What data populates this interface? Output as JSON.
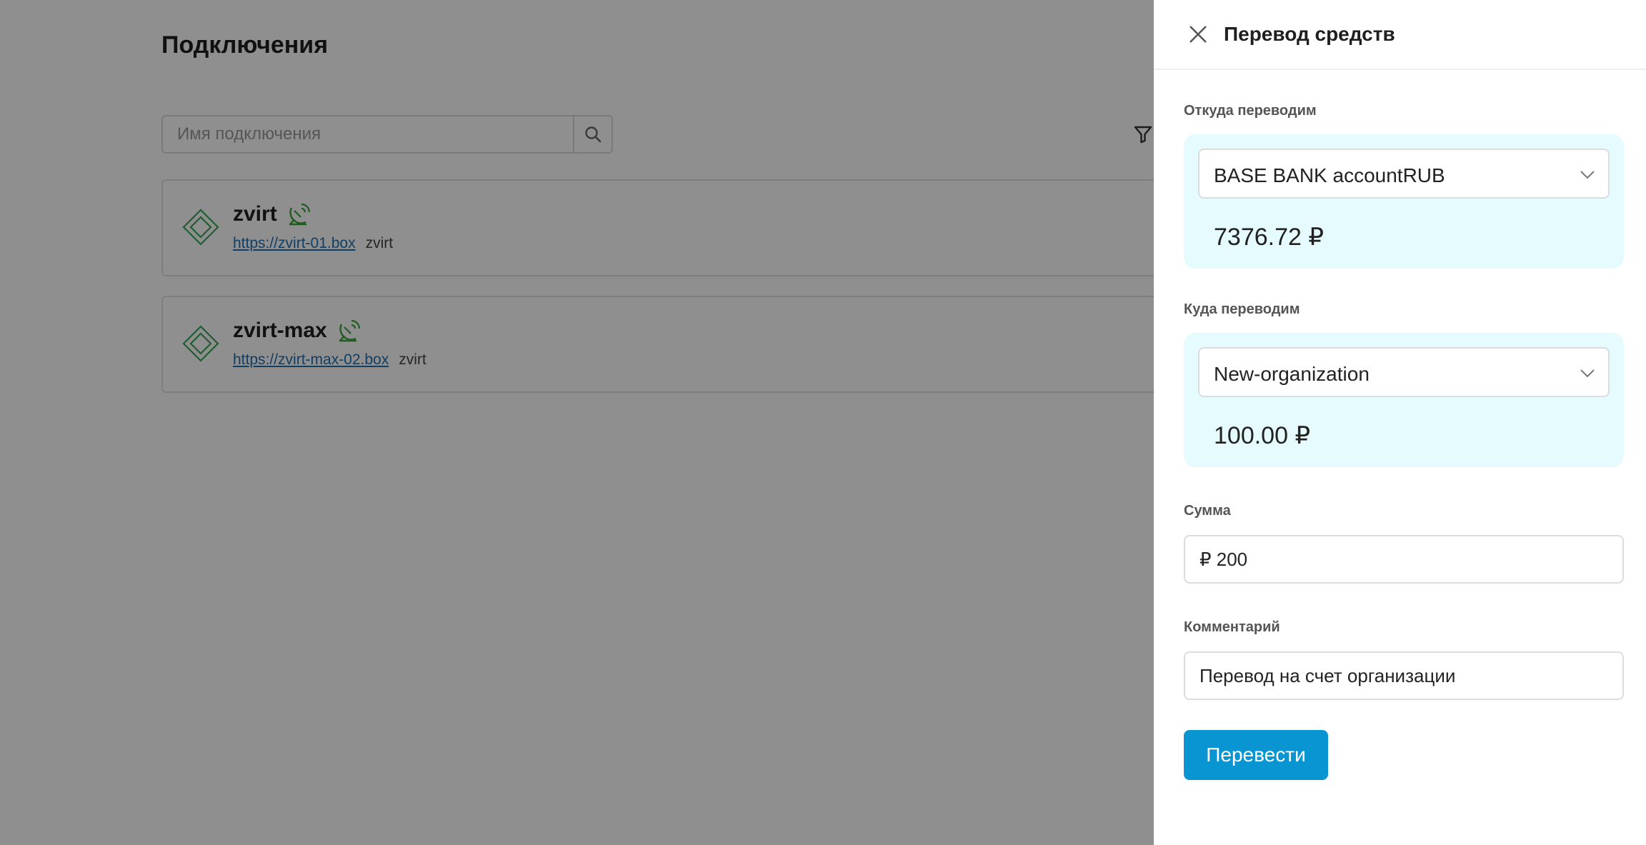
{
  "page": {
    "title": "Подключения",
    "search": {
      "placeholder": "Имя подключения"
    },
    "connections": [
      {
        "name": "zvirt",
        "url": "https://zvirt-01.box",
        "type": "zvirt"
      },
      {
        "name": "zvirt-max",
        "url": "https://zvirt-max-02.box",
        "type": "zvirt"
      }
    ]
  },
  "drawer": {
    "title": "Перевод средств",
    "from": {
      "label": "Откуда переводим",
      "account": "BASE BANK accountRUB",
      "balance": "7376.72 ₽"
    },
    "to": {
      "label": "Куда переводим",
      "account": "New-organization",
      "balance": "100.00 ₽"
    },
    "amount": {
      "label": "Сумма",
      "value": "₽ 200"
    },
    "comment": {
      "label": "Комментарий",
      "value": "Перевод на счет организации"
    },
    "submit_label": "Перевести"
  },
  "colors": {
    "accent": "#0995d2",
    "account_box": "#e6fbfd",
    "status_green": "#3aa33a",
    "logo_green": "#3aa65a",
    "link": "#1f6fb0"
  }
}
